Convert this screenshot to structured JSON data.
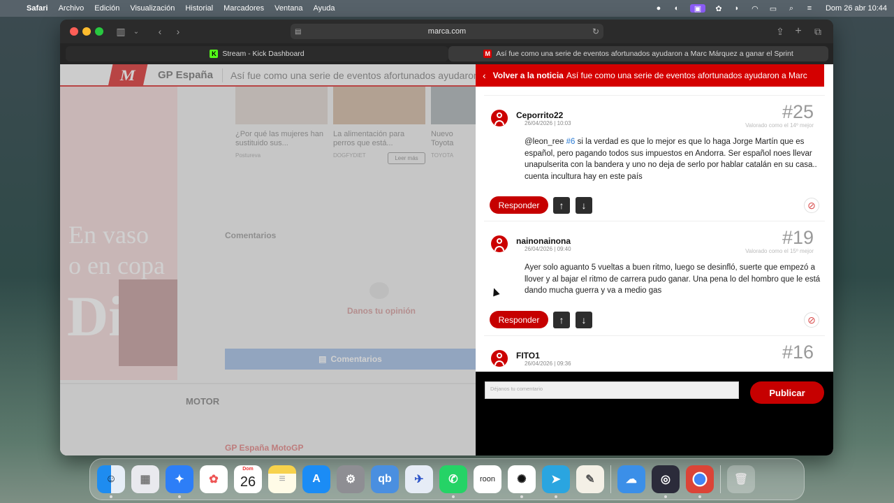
{
  "menubar": {
    "app": "Safari",
    "items": [
      "Archivo",
      "Edición",
      "Visualización",
      "Historial",
      "Marcadores",
      "Ventana",
      "Ayuda"
    ],
    "clock": "Dom 26 abr 10:44"
  },
  "browser": {
    "url": "marca.com",
    "tabs": [
      {
        "label": "Stream - Kick Dashboard",
        "favicon": "K"
      },
      {
        "label": "Así fue como una serie de eventos afortunados ayudaron a Marc Márquez a ganar el Sprint",
        "favicon": "M"
      }
    ]
  },
  "site": {
    "logo": "M",
    "section": "GP España",
    "headline": "Así fue como una serie de eventos afortunados ayudaron a Marc",
    "ad": {
      "line1": "En vaso",
      "line2": "o en copa",
      "big": "Di"
    },
    "thumbs": [
      {
        "caption": "¿Por qué las mujeres han sustituido sus...",
        "source": "Postureva"
      },
      {
        "caption": "La alimentación para perros que está...",
        "source": "DOGFYDIET"
      },
      {
        "caption": "Nuevo Toyota eléctrico.",
        "source": "TOYOTA"
      }
    ],
    "leer_mas": "Leer más",
    "comments_heading": "Comentarios",
    "danos": "Danos tu opinión",
    "comments_button": "Comentarios",
    "motor": "MOTOR",
    "gp_motogp": "GP España MotoGP"
  },
  "panel": {
    "back_label": "Volver a la noticia",
    "title": "Así fue como una serie de eventos afortunados ayudaron a Marc",
    "reply_label": "Responder",
    "comments": [
      {
        "author": "Ceporrito22",
        "date": "26/04/2026 | 10:03",
        "number": "#25",
        "rated": "Valorado como el 14º mejor",
        "mention": "@leon_ree",
        "ref": "#6",
        "text": " si la verdad es que lo mejor es que lo haga Jorge Martín que es español, pero pagando todos sus impuestos en Andorra. Ser español noes llevar unapulserita con la bandera y uno no deja de serlo por hablar catalán en su casa.. cuenta incultura hay en este país"
      },
      {
        "author": "nainonainona",
        "date": "26/04/2026 | 09:40",
        "number": "#19",
        "rated": "Valorado como el 15º mejor",
        "text": "Ayer solo aguanto 5 vueltas a buen ritmo, luego se desinfló, suerte que empezó a llover y al bajar el ritmo de carrera pudo ganar. Una pena lo del hombro que le está dando mucha guerra y va a medio gas"
      },
      {
        "author": "FITO1",
        "date": "26/04/2026 | 09:36",
        "number": "#16"
      }
    ],
    "compose_placeholder": "Déjanos tu comentario",
    "publish_label": "Publicar"
  },
  "dock": {
    "calendar_month": "Dom",
    "calendar_day": "26",
    "qb": "qb",
    "roon": "roon",
    "apps": [
      "finder-icon",
      "launchpad-icon",
      "safari-icon",
      "photos-icon",
      "calendar-icon",
      "notes-icon",
      "app-store-icon",
      "settings-icon",
      "qbittorrent-icon",
      "flight-icon",
      "whatsapp-icon",
      "roon-icon",
      "chatgpt-icon",
      "telegram-icon",
      "textedit-icon",
      "weather-icon",
      "obs-icon",
      "chrome-icon",
      "trash-icon"
    ]
  }
}
